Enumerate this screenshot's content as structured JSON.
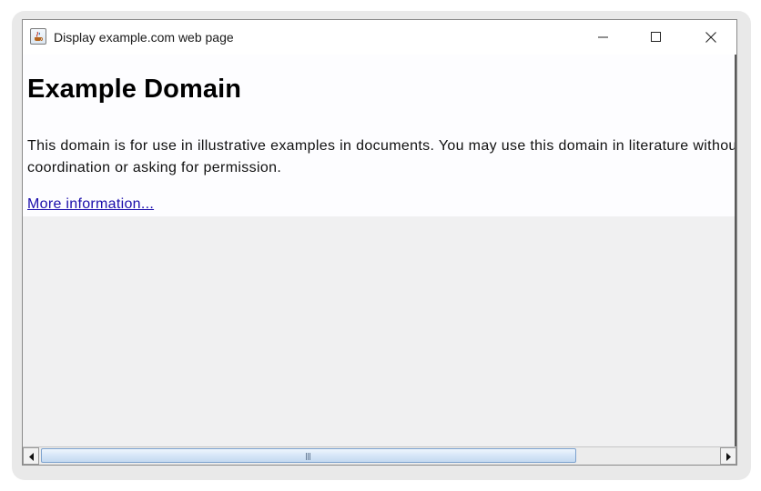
{
  "window": {
    "title": "Display example.com web page",
    "app_icon": "java-cup-icon"
  },
  "controls": {
    "minimize": "minimize-icon",
    "maximize": "maximize-icon",
    "close": "close-icon"
  },
  "page": {
    "heading": "Example Domain",
    "paragraph": "This domain is for use in illustrative examples in documents. You may use this domain in literature without prior coordination or asking for permission.",
    "link_text": "More information..."
  },
  "scrollbar": {
    "orientation": "horizontal",
    "thumb_fraction": 0.79,
    "position": 0
  },
  "colors": {
    "link": "#1a0dab",
    "page_background": "#fdfdff",
    "empty_background": "#f0f0f1",
    "scroll_thumb": "#d6e6f8"
  }
}
